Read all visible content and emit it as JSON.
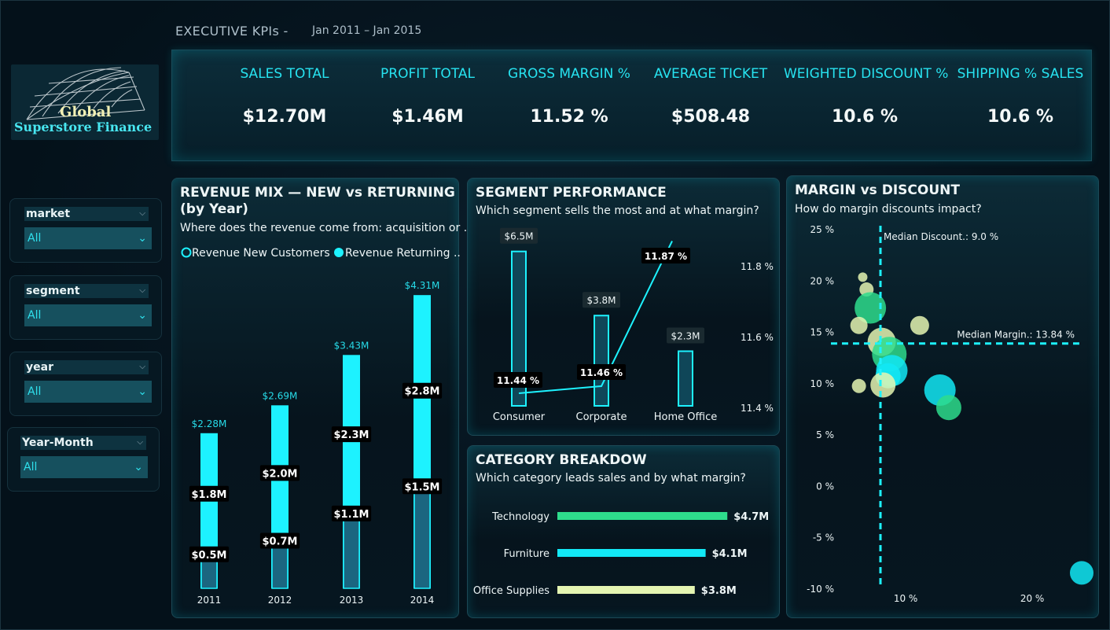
{
  "header": {
    "title": "EXECUTIVE KPIs  -",
    "date_range": "Jan 2011 – Jan 2015"
  },
  "logo": {
    "line1": "Global",
    "line2": "Superstore Finance"
  },
  "kpis": [
    {
      "label": "SALES TOTAL",
      "value": "$12.70M"
    },
    {
      "label": "PROFIT TOTAL",
      "value": "$1.46M"
    },
    {
      "label": "GROSS MARGIN %",
      "value": "11.52 %"
    },
    {
      "label": "AVERAGE TICKET",
      "value": "$508.48"
    },
    {
      "label": "WEIGHTED DISCOUNT %",
      "value": "10.6 %"
    },
    {
      "label": "SHIPPING % SALES",
      "value": "10.6 %"
    }
  ],
  "slicers": [
    {
      "title": "market",
      "value": "All"
    },
    {
      "title": "segment",
      "value": "All"
    },
    {
      "title": "year",
      "value": "All"
    },
    {
      "title": "Year-Month",
      "value": "All"
    }
  ],
  "colors": {
    "accent": "#1df2ff",
    "dark_bar": "#1b6680",
    "technology": "#2edc8c",
    "furniture": "#12e8f5",
    "office_supplies": "#e4f5b2"
  },
  "chart_data": [
    {
      "type": "bar",
      "title": "REVENUE MIX — NEW vs RETURNING (by Year)",
      "subtitle": "Where does the revenue come from: acquisition or ...",
      "legend": [
        "Revenue New Customers",
        "Revenue Returning ..."
      ],
      "categories": [
        "2011",
        "2012",
        "2013",
        "2014"
      ],
      "totals": [
        "$2.28M",
        "$2.69M",
        "$3.43M",
        "$4.31M"
      ],
      "total_values": [
        2.28,
        2.69,
        3.43,
        4.31
      ],
      "series": [
        {
          "name": "Revenue New Customers",
          "values": [
            0.5,
            0.7,
            1.1,
            1.5
          ],
          "labels": [
            "$0.5M",
            "$0.7M",
            "$1.1M",
            "$1.5M"
          ]
        },
        {
          "name": "Revenue Returning ...",
          "values": [
            1.8,
            2.0,
            2.3,
            2.8
          ],
          "labels": [
            "$1.8M",
            "$2.0M",
            "$2.3M",
            "$2.8M"
          ]
        }
      ]
    },
    {
      "type": "bar",
      "title": "SEGMENT PERFORMANCE",
      "subtitle": "Which segment sells the most and at what margin?",
      "categories": [
        "Consumer",
        "Corporate",
        "Home Office"
      ],
      "sales": [
        6.5,
        3.8,
        2.3
      ],
      "sales_labels": [
        "$6.5M",
        "$3.8M",
        "$2.3M"
      ],
      "margin": [
        11.44,
        11.46,
        11.87
      ],
      "margin_labels": [
        "11.44 %",
        "11.46 %",
        "11.87 %"
      ],
      "y2_ticks": [
        "11.8 %",
        "11.6 %",
        "11.4 %"
      ],
      "y2_range": [
        11.4,
        11.8
      ]
    },
    {
      "type": "bar",
      "orientation": "horizontal",
      "title": "CATEGORY BREAKDOW",
      "subtitle": "Which category leads sales and by what margin?",
      "categories": [
        "Technology",
        "Furniture",
        "Office Supplies"
      ],
      "values": [
        4.7,
        4.1,
        3.8
      ],
      "labels": [
        "$4.7M",
        "$4.1M",
        "$3.8M"
      ]
    },
    {
      "type": "scatter",
      "title": "MARGIN vs DISCOUNT",
      "subtitle": "How do margin discounts impact?",
      "y_ticks": [
        "25 %",
        "20 %",
        "15 %",
        "10 %",
        "5 %",
        "0 %",
        "-5 %",
        "-10 %"
      ],
      "x_ticks": [
        "10 %",
        "20 %"
      ],
      "ylim": [
        -10,
        25
      ],
      "median_discount_label": "Median Discount.: 9.0 %",
      "median_discount": 9.0,
      "median_margin_label": "Median Margin.: 13.84 %",
      "median_margin": 13.84,
      "points": [
        {
          "x": 7.6,
          "y": 20.3,
          "r": 6,
          "color": "#e4f5b2"
        },
        {
          "x": 7.9,
          "y": 19.1,
          "r": 9,
          "color": "#e4f5b2"
        },
        {
          "x": 8.2,
          "y": 17.3,
          "r": 20,
          "color": "#2edc8c"
        },
        {
          "x": 7.3,
          "y": 15.6,
          "r": 11,
          "color": "#e4f5b2"
        },
        {
          "x": 12.1,
          "y": 15.6,
          "r": 12,
          "color": "#e4f5b2"
        },
        {
          "x": 9.1,
          "y": 14.0,
          "r": 18,
          "color": "#e4f5b2"
        },
        {
          "x": 9.7,
          "y": 12.8,
          "r": 22,
          "color": "#2edc8c"
        },
        {
          "x": 9.9,
          "y": 11.2,
          "r": 20,
          "color": "#12e8f5"
        },
        {
          "x": 9.6,
          "y": 10.7,
          "r": 16,
          "color": "#12e8f5"
        },
        {
          "x": 9.2,
          "y": 9.8,
          "r": 16,
          "color": "#e4f5b2"
        },
        {
          "x": 7.3,
          "y": 9.7,
          "r": 9,
          "color": "#e4f5b2"
        },
        {
          "x": 13.7,
          "y": 9.3,
          "r": 20,
          "color": "#12e8f5"
        },
        {
          "x": 14.4,
          "y": 7.6,
          "r": 16,
          "color": "#2edc8c"
        },
        {
          "x": 24.9,
          "y": -8.5,
          "r": 15,
          "color": "#12e8f5"
        }
      ]
    }
  ]
}
